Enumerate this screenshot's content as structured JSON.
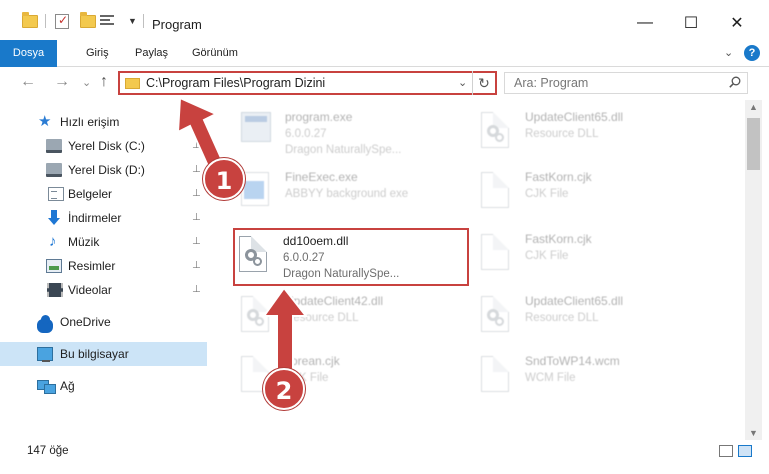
{
  "window": {
    "title": "Program",
    "minimize_glyph": "—",
    "maximize_glyph": "☐",
    "close_glyph": "✕"
  },
  "ribbon": {
    "tabs": [
      {
        "label": "Dosya"
      },
      {
        "label": "Giriş"
      },
      {
        "label": "Paylaş"
      },
      {
        "label": "Görünüm"
      }
    ],
    "help_glyph": "?",
    "collapse_glyph": "⌄"
  },
  "navigation": {
    "back_glyph": "←",
    "forward_glyph": "→",
    "recent_glyph": "⌄",
    "up_glyph": "↑",
    "address_path": "C:\\Program Files\\Program Dizini",
    "address_dropdown_glyph": "⌄",
    "refresh_glyph": "↻",
    "search_placeholder": "Ara: Program"
  },
  "sidebar": {
    "items": [
      {
        "label": "Hızlı erişim",
        "icon": "star-icon",
        "pinned": false
      },
      {
        "label": "Yerel Disk (C:)",
        "icon": "drive-icon",
        "pinned": true
      },
      {
        "label": "Yerel Disk (D:)",
        "icon": "drive-icon",
        "pinned": true
      },
      {
        "label": "Belgeler",
        "icon": "documents-icon",
        "pinned": true
      },
      {
        "label": "İndirmeler",
        "icon": "downloads-icon",
        "pinned": true
      },
      {
        "label": "Müzik",
        "icon": "music-icon",
        "pinned": true
      },
      {
        "label": "Resimler",
        "icon": "pictures-icon",
        "pinned": true
      },
      {
        "label": "Videolar",
        "icon": "videos-icon",
        "pinned": true
      },
      {
        "label": "OneDrive",
        "icon": "onedrive-icon",
        "pinned": false
      },
      {
        "label": "Bu bilgisayar",
        "icon": "this-pc-icon",
        "pinned": false,
        "selected": true
      },
      {
        "label": "Ağ",
        "icon": "network-icon",
        "pinned": false
      }
    ],
    "pin_glyph": "📌",
    "music_glyph": "♪",
    "star_glyph": "★"
  },
  "files": [
    {
      "name": "program.exe",
      "line1": "6.0.0.27",
      "line2": "Dragon NaturallySpe...",
      "icon": "exe-icon",
      "faded": true
    },
    {
      "name": "UpdateClient65.dll",
      "line1": "Resource DLL",
      "line2": "",
      "icon": "dll-icon",
      "faded": true
    },
    {
      "name": "FineExec.exe",
      "line1": "ABBYY background exe",
      "line2": "",
      "icon": "app-icon",
      "faded": true
    },
    {
      "name": "FastKorn.cjk",
      "line1": "CJK File",
      "line2": "",
      "icon": "file-icon",
      "faded": true
    },
    {
      "name": "dd10oem.dll",
      "line1": "6.0.0.27",
      "line2": "Dragon NaturallySpe...",
      "icon": "dll-icon",
      "faded": false,
      "highlighted": true
    },
    {
      "name": "FastKorn.cjk",
      "line1": "CJK File",
      "line2": "",
      "icon": "file-icon",
      "faded": true
    },
    {
      "name": "UpdateClient42.dll",
      "line1": "Resource DLL",
      "line2": "",
      "icon": "dll-icon",
      "faded": true
    },
    {
      "name": "UpdateClient65.dll",
      "line1": "Resource DLL",
      "line2": "",
      "icon": "dll-icon",
      "faded": true
    },
    {
      "name": "korean.cjk",
      "line1": "CJK File",
      "line2": "",
      "icon": "file-icon",
      "faded": true
    },
    {
      "name": "SndToWP14.wcm",
      "line1": "WCM File",
      "line2": "",
      "icon": "file-icon",
      "faded": true
    }
  ],
  "statusbar": {
    "item_count": "147 öğe"
  },
  "annotations": {
    "step1": "1",
    "step2": "2",
    "color": "#c8423f"
  },
  "colors": {
    "accent": "#1979ca",
    "selection": "#cce4f7",
    "highlight_border": "#c8423f"
  }
}
